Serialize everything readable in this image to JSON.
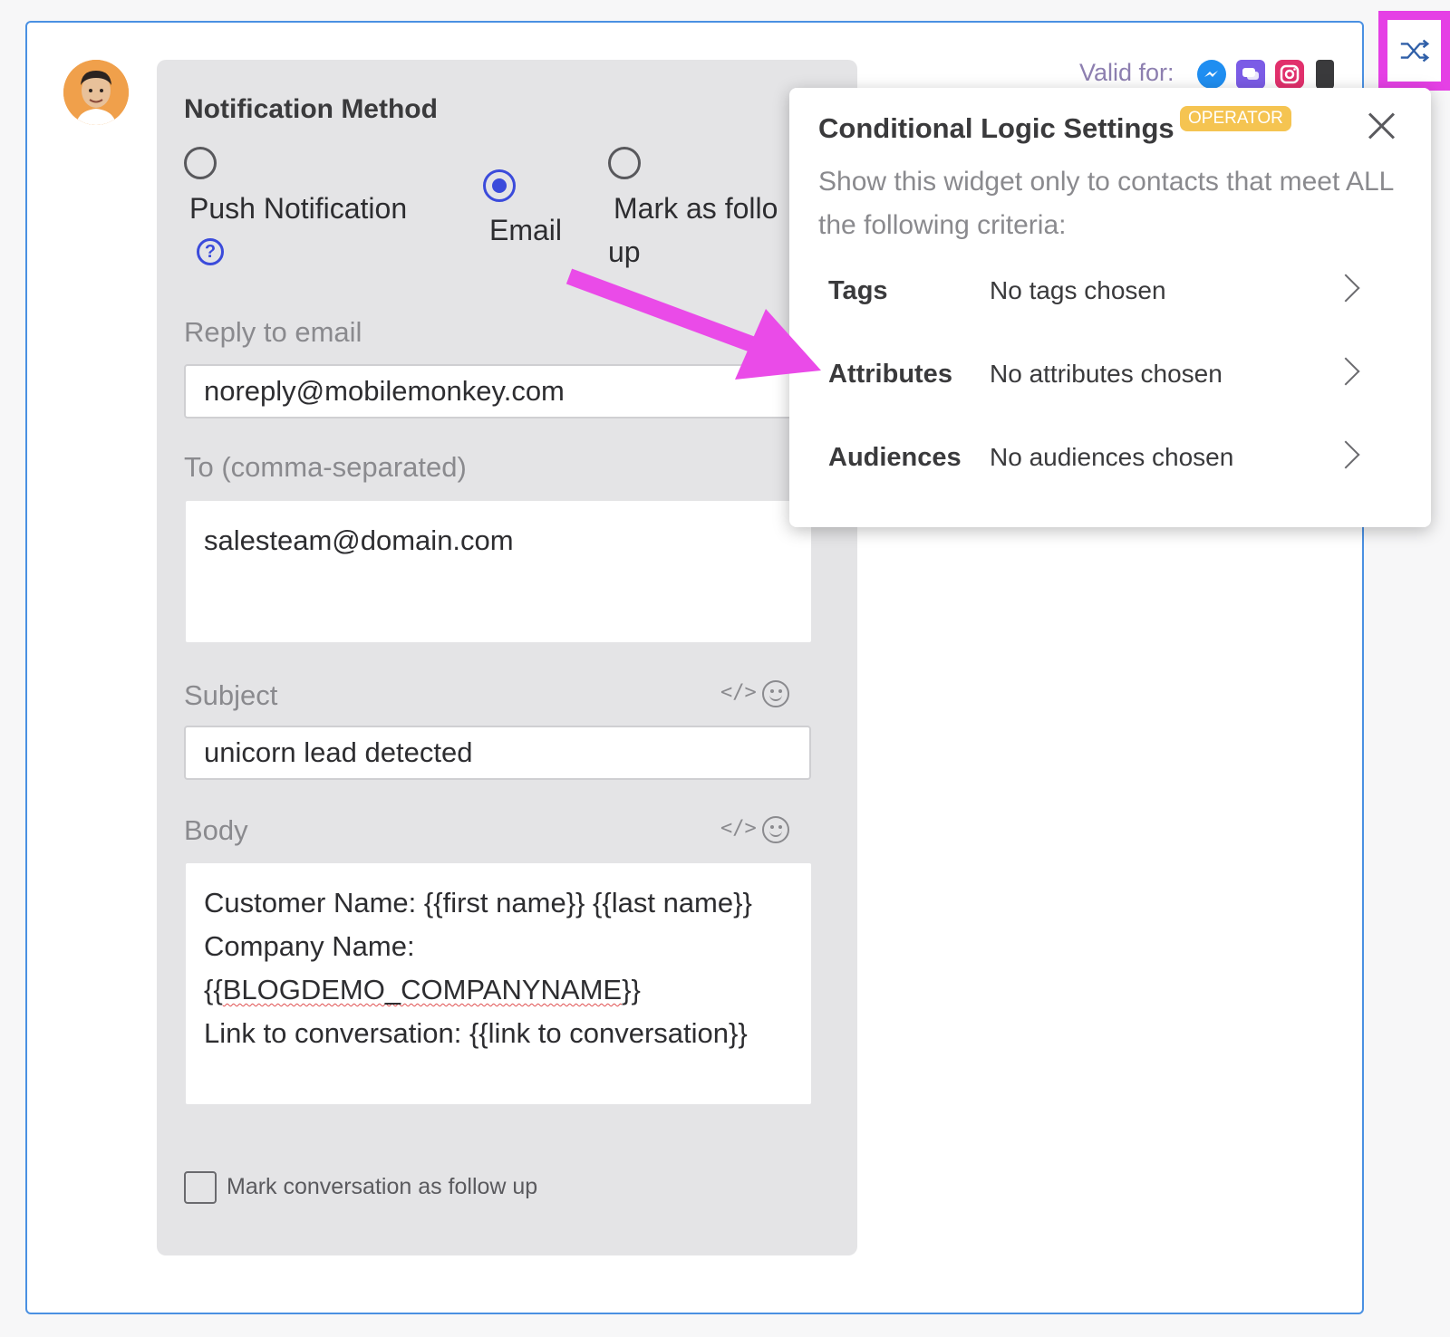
{
  "form": {
    "section_title": "Notification Method",
    "options": {
      "push": "Push Notification",
      "email": "Email",
      "mark_line1": "Mark as follo",
      "mark_line2": "up"
    },
    "selected_option": "Email",
    "help_icon": "?",
    "reply_to": {
      "label": "Reply to email",
      "value": "noreply@mobilemonkey.com"
    },
    "to": {
      "label": "To (comma-separated)",
      "value": "salesteam@domain.com"
    },
    "subject": {
      "label": "Subject",
      "value": "unicorn lead detected",
      "code_icon": "</>"
    },
    "body": {
      "label": "Body",
      "code_icon": "</>",
      "line1": "Customer Name: {{first name}} {{last name}}",
      "line2": "Company Name:",
      "line3_prefix": "{{",
      "line3_word": "BLOGDEMO_COMPANYNAME",
      "line3_suffix": "}}",
      "line4": "Link to conversation: {{link to conversation}}"
    },
    "followup_checkbox": {
      "label": "Mark conversation as follow up",
      "checked": false
    }
  },
  "header": {
    "valid_for": "Valid for:",
    "channels": [
      "messenger-icon",
      "chat-icon",
      "instagram-icon",
      "phone-icon"
    ],
    "shuffle_icon": "shuffle-icon"
  },
  "popup": {
    "title": "Conditional Logic Settings",
    "badge": "OPERATOR",
    "description": "Show this widget only to contacts that meet ALL the following criteria:",
    "criteria": [
      {
        "label": "Tags",
        "value": "No tags chosen"
      },
      {
        "label": "Attributes",
        "value": "No attributes chosen"
      },
      {
        "label": "Audiences",
        "value": "No audiences chosen"
      }
    ]
  },
  "colors": {
    "accent_blue": "#3b4bdb",
    "highlight_magenta": "#e540e5",
    "badge_yellow": "#f5c451",
    "border_blue": "#4a90e2"
  }
}
